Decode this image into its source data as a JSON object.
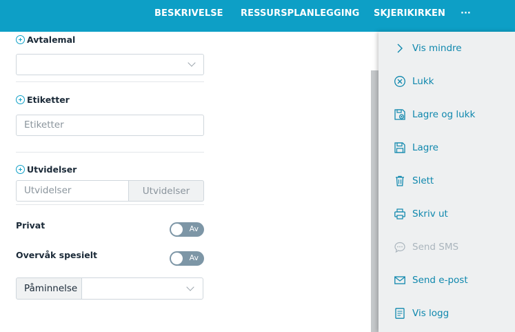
{
  "topnav": {
    "items": [
      {
        "label": "BESKRIVELSE"
      },
      {
        "label": "RESSURSPLANLEGGING"
      },
      {
        "label": "SKJERIKIRKEN"
      }
    ],
    "more_label": "···"
  },
  "form": {
    "avtalemal": {
      "label": "Avtalemal",
      "value": ""
    },
    "etiketter": {
      "label": "Etiketter",
      "placeholder": "Etiketter"
    },
    "utvidelser": {
      "label": "Utvidelser",
      "placeholder": "Utvidelser",
      "button_label": "Utvidelser"
    },
    "privat": {
      "label": "Privat",
      "toggle_label": "Av"
    },
    "overvak": {
      "label": "Overvåk spesielt",
      "toggle_label": "Av"
    },
    "paminnelse": {
      "prefix": "Påminnelse",
      "value": ""
    }
  },
  "menu": {
    "items": [
      {
        "label": "Vis mindre",
        "icon": "chevron-right-icon",
        "enabled": true
      },
      {
        "label": "Lukk",
        "icon": "close-circle-icon",
        "enabled": true
      },
      {
        "label": "Lagre og lukk",
        "icon": "save-close-icon",
        "enabled": true
      },
      {
        "label": "Lagre",
        "icon": "save-icon",
        "enabled": true
      },
      {
        "label": "Slett",
        "icon": "trash-icon",
        "enabled": true
      },
      {
        "label": "Skriv ut",
        "icon": "printer-icon",
        "enabled": true
      },
      {
        "label": "Send SMS",
        "icon": "chat-bubble-icon",
        "enabled": false
      },
      {
        "label": "Send e-post",
        "icon": "envelope-icon",
        "enabled": true
      },
      {
        "label": "Vis logg",
        "icon": "document-log-icon",
        "enabled": true
      }
    ]
  },
  "colors": {
    "accent": "#0d9fc6",
    "menu_text": "#0e87ad",
    "disabled_text": "#aab5bd",
    "toggle_off": "#7d96a6"
  }
}
